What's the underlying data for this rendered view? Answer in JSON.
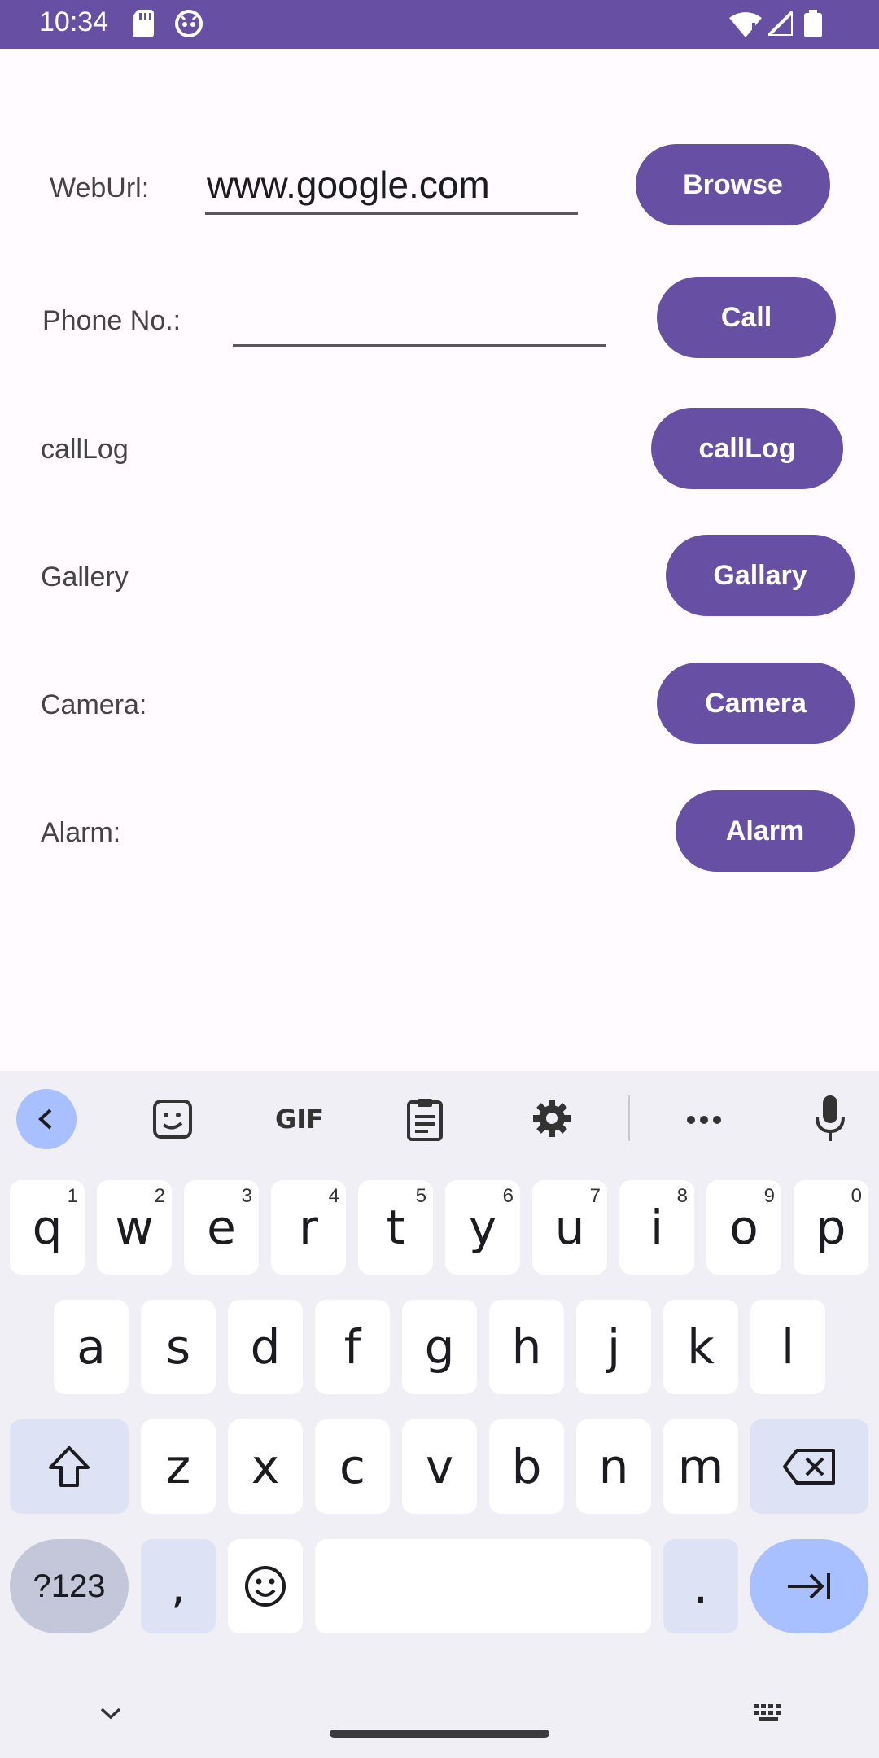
{
  "status_bar": {
    "time": "10:34"
  },
  "form": {
    "web_url": {
      "label": "WebUrl:",
      "value": "www.google.com",
      "button": "Browse"
    },
    "phone": {
      "label": "Phone No.:",
      "value": "",
      "button": "Call"
    },
    "call_log": {
      "label": "callLog",
      "button": "callLog"
    },
    "gallery": {
      "label": "Gallery",
      "button": "Gallary"
    },
    "camera": {
      "label": "Camera:",
      "button": "Camera"
    },
    "alarm": {
      "label": "Alarm:",
      "button": "Alarm"
    }
  },
  "keyboard": {
    "toolbar": {
      "gif": "GIF"
    },
    "row1": [
      {
        "k": "q",
        "h": "1"
      },
      {
        "k": "w",
        "h": "2"
      },
      {
        "k": "e",
        "h": "3"
      },
      {
        "k": "r",
        "h": "4"
      },
      {
        "k": "t",
        "h": "5"
      },
      {
        "k": "y",
        "h": "6"
      },
      {
        "k": "u",
        "h": "7"
      },
      {
        "k": "i",
        "h": "8"
      },
      {
        "k": "o",
        "h": "9"
      },
      {
        "k": "p",
        "h": "0"
      }
    ],
    "row2": [
      "a",
      "s",
      "d",
      "f",
      "g",
      "h",
      "j",
      "k",
      "l"
    ],
    "row3": [
      "z",
      "x",
      "c",
      "v",
      "b",
      "n",
      "m"
    ],
    "symbols": "?123",
    "comma": ",",
    "period": "."
  },
  "colors": {
    "primary": "#6750a4",
    "background": "#fffbfe",
    "keyboard_bg": "#f0eff5",
    "accent_key": "#a8c0ff"
  }
}
